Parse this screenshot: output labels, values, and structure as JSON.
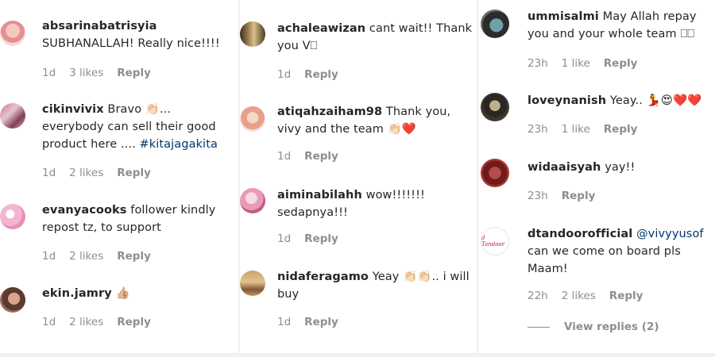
{
  "columns": [
    {
      "comments": [
        {
          "username": "absarinabatrisyia",
          "text": "SUBHANALLAH! Really nice!!!!",
          "age": "1d",
          "likes": "3 likes",
          "reply": "Reply"
        },
        {
          "username": "cikinvivix",
          "text": "Bravo 👏🏻...\neverybody can sell their good\nproduct here .... ",
          "hashtag": "#kitajagakita",
          "age": "1d",
          "likes": "2 likes",
          "reply": "Reply"
        },
        {
          "username": "evanyacooks",
          "text": "follower kindly\nrepost tz, to support",
          "age": "1d",
          "likes": "2 likes",
          "reply": "Reply"
        },
        {
          "username": "ekin.jamry",
          "text": "👍🏼",
          "age": "1d",
          "likes": "2 likes",
          "reply": "Reply"
        }
      ]
    },
    {
      "comments": [
        {
          "username": "achaleawizan",
          "text": "cant wait!! Thank\nyou V⎕",
          "age": "1d",
          "reply": "Reply"
        },
        {
          "username": "atiqahzaiham98",
          "text": "Thank you,\nvivy and the team 👏🏻❤️",
          "age": "1d",
          "reply": "Reply"
        },
        {
          "username": "aiminabilahh",
          "text": "wow!!!!!!!\nsedapnya!!!",
          "age": "1d",
          "reply": "Reply"
        },
        {
          "username": "nidaferagamo",
          "text": "Yeay 👏🏻👏🏻.. i will\nbuy",
          "age": "1d",
          "reply": "Reply"
        }
      ]
    },
    {
      "comments": [
        {
          "username": "ummisalmi",
          "text": "May Allah repay\nyou and your whole team ⎕⎕",
          "age": "23h",
          "likes": "1 like",
          "reply": "Reply"
        },
        {
          "username": "loveynanish",
          "text": "Yeay.. 💃😍❤️❤️",
          "age": "23h",
          "likes": "1 like",
          "reply": "Reply"
        },
        {
          "username": "widaaisyah",
          "text": "yay!!",
          "age": "23h",
          "reply": "Reply"
        },
        {
          "username": "dtandoorofficial",
          "mention": "@vivyyusof",
          "text": "\ncan we come on board pls\nMaam!",
          "age": "22h",
          "likes": "2 likes",
          "reply": "Reply",
          "view_replies": "View replies (2)",
          "avatar_logo": "d Tandoor"
        }
      ]
    }
  ],
  "colors": {
    "text": "#262626",
    "meta": "#8e8e8e",
    "mention": "#00376b",
    "background": "#ffffff",
    "gutter": "#f1f1f1"
  }
}
